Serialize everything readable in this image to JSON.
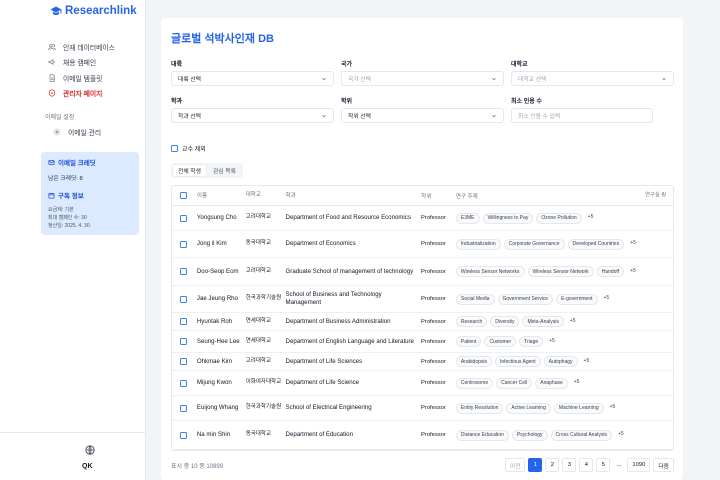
{
  "app": {
    "logo_text": "Researchlink"
  },
  "sidebar": {
    "items": [
      {
        "label": "인재 데이터베이스",
        "icon": "users-icon"
      },
      {
        "label": "채용 캠페인",
        "icon": "megaphone-icon"
      },
      {
        "label": "이메일 템플릿",
        "icon": "document-icon"
      },
      {
        "label": "관리자 페이지",
        "icon": "shield-icon",
        "active": true
      }
    ],
    "email_section_label": "이메일 설정",
    "email_items": [
      {
        "label": "이메일 관리",
        "icon": "gear-icon"
      }
    ],
    "credit": {
      "title": "이메일 크레딧",
      "remaining": "남은 크레딧: 8",
      "sub_title": "구독 정보",
      "plan": "요금제: 기본",
      "max_campaigns": "최대 캠페인 수: 30",
      "renewal": "정산일: 2025. 4. 30."
    },
    "avatar_initials": "QK"
  },
  "page": {
    "title": "글로벌 석박사인재 DB",
    "filters": {
      "region_label": "대륙",
      "region_value": "대륙 선택",
      "country_label": "국가",
      "country_placeholder": "국가 선택",
      "university_label": "대학교",
      "university_placeholder": "대학교 선택",
      "dept_label": "학과",
      "dept_value": "학과 선택",
      "degree_label": "학위",
      "degree_value": "학위 선택",
      "min_citations_label": "최소 인용 수",
      "min_citations_placeholder": "최소 인용 수 입력"
    },
    "exclude_professor_label": "교수 제외",
    "tabs": [
      "전체 학생",
      "관심 목록"
    ],
    "columns": {
      "name": "이름",
      "university": "대학교",
      "department": "학과",
      "degree": "학위",
      "topics": "연구 주제",
      "action": "연구실 링"
    },
    "rows": [
      {
        "name": "Yongsung Cho",
        "university": "고려대학교",
        "department": "Department of Food and Resource Economics",
        "degree": "Professor",
        "topics": [
          "E3ME",
          "Willingness to Pay",
          "Ozone Pollution"
        ],
        "more": "+5"
      },
      {
        "name": "Jong il Kim",
        "university": "동국대학교",
        "department": "Department of Economics",
        "degree": "Professor",
        "topics": [
          "Industrialization",
          "Corporate Governance",
          "Developed Countries"
        ],
        "more": "+5"
      },
      {
        "name": "Doo-Seop Eom",
        "university": "고려대학교",
        "department": "Graduate School of management of technology",
        "degree": "Professor",
        "topics": [
          "Wireless Sensor Networks",
          "Wireless Sensor Network",
          "Handoff"
        ],
        "more": "+5"
      },
      {
        "name": "Jae Jeung Rho",
        "university": "한국과학기술원",
        "department": "School of Business and Technology Management",
        "degree": "Professor",
        "topics": [
          "Social Media",
          "Government Service",
          "E-government"
        ],
        "more": "+5"
      },
      {
        "name": "Hyuntak Roh",
        "university": "연세대학교",
        "department": "Department of Business Administration",
        "degree": "Professor",
        "topics": [
          "Research",
          "Diversity",
          "Meta-Analysis"
        ],
        "more": "+5"
      },
      {
        "name": "Seung-Hee Lee",
        "university": "연세대학교",
        "department": "Department of English Language and Literature",
        "degree": "Professor",
        "topics": [
          "Patient",
          "Customer",
          "Triage"
        ],
        "more": "+5"
      },
      {
        "name": "Ohkmae Kim",
        "university": "고려대학교",
        "department": "Department of Life Sciences",
        "degree": "Professor",
        "topics": [
          "Arabidopsis",
          "Infectious Agent",
          "Autophagy"
        ],
        "more": "+5"
      },
      {
        "name": "Mijung Kwon",
        "university": "이화여자대학교",
        "department": "Department of Life Science",
        "degree": "Professor",
        "topics": [
          "Centrosome",
          "Cancer Cell",
          "Anaphase"
        ],
        "more": "+5"
      },
      {
        "name": "Euijong Whang",
        "university": "한국과학기술원",
        "department": "School of Electrical Engineering",
        "degree": "Professor",
        "topics": [
          "Entity Resolution",
          "Active Learning",
          "Machine Learning"
        ],
        "more": "+5"
      },
      {
        "name": "Na min Shin",
        "university": "동국대학교",
        "department": "Department of Education",
        "degree": "Professor",
        "topics": [
          "Distance Education",
          "Psychology",
          "Cross Cultural Analysis"
        ],
        "more": "+5"
      }
    ],
    "total_text": "표시 중 10 중 10899",
    "pagination": {
      "prev": "이전",
      "pages": [
        "1",
        "2",
        "3",
        "4",
        "5"
      ],
      "ellipsis": "...",
      "last": "1090",
      "next": "다음"
    }
  }
}
